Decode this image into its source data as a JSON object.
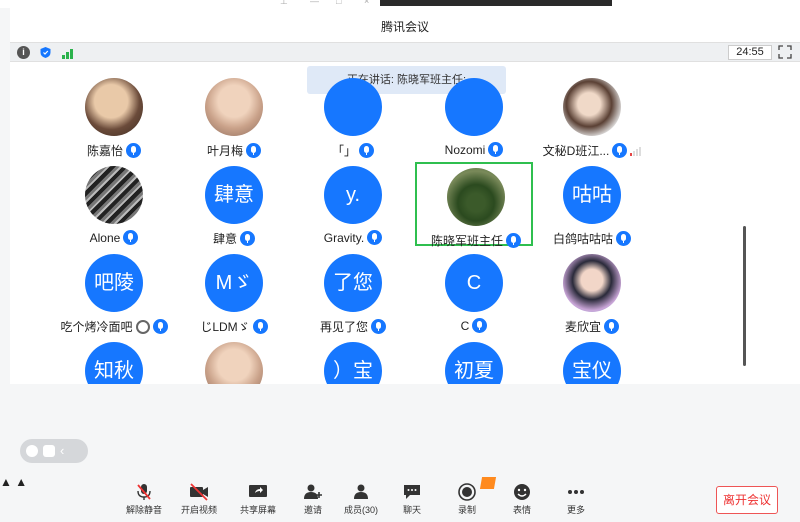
{
  "app": {
    "title": "腾讯会议"
  },
  "toolbar": {
    "timer": "24:55"
  },
  "speaker_banner": {
    "text": "正在讲话: 陈晓军班主任;"
  },
  "participants": [
    {
      "name": "陈嘉怡",
      "avatar_text": "",
      "avatar_style": "photo-a",
      "mic": true
    },
    {
      "name": "叶月梅",
      "avatar_text": "",
      "avatar_style": "photo-b",
      "mic": true
    },
    {
      "name": "「」",
      "avatar_text": "",
      "avatar_style": "blue",
      "mic": true
    },
    {
      "name": "Nozomi",
      "avatar_text": "",
      "avatar_style": "blue",
      "mic": true
    },
    {
      "name": "文秘D班江...",
      "avatar_text": "",
      "avatar_style": "photo-f",
      "mic": true,
      "net": true
    },
    {
      "name": "Alone",
      "avatar_text": "",
      "avatar_style": "photo-c",
      "mic": true
    },
    {
      "name": "肆意",
      "avatar_text": "肆意",
      "avatar_style": "blue",
      "mic": true
    },
    {
      "name": "Gravity.",
      "avatar_text": "y.",
      "avatar_style": "blue",
      "mic": true
    },
    {
      "name": "陈晓军班主任",
      "avatar_text": "",
      "avatar_style": "photo-d",
      "mic": true,
      "active": true
    },
    {
      "name": "白鸽咕咕咕",
      "avatar_text": "咕咕",
      "avatar_style": "blue",
      "mic": true
    },
    {
      "name": "吃个烤冷面吧",
      "avatar_text": "吧陵",
      "avatar_style": "blue",
      "mic": true,
      "extra_icon": true
    },
    {
      "name": "じLDMゞ",
      "avatar_text": "Mゞ",
      "avatar_style": "blue",
      "mic": true
    },
    {
      "name": "再见了您",
      "avatar_text": "了您",
      "avatar_style": "blue",
      "mic": true
    },
    {
      "name": "C",
      "avatar_text": "C",
      "avatar_style": "blue",
      "mic": true
    },
    {
      "name": "麦欣宜",
      "avatar_text": "",
      "avatar_style": "photo-e",
      "mic": true
    },
    {
      "name": "",
      "avatar_text": "知秋",
      "avatar_style": "blue",
      "mic": false
    },
    {
      "name": "",
      "avatar_text": "",
      "avatar_style": "photo-b",
      "mic": false
    },
    {
      "name": "",
      "avatar_text": "）宝",
      "avatar_style": "blue",
      "mic": false
    },
    {
      "name": "",
      "avatar_text": "初夏",
      "avatar_style": "blue",
      "mic": false
    },
    {
      "name": "",
      "avatar_text": "宝仪",
      "avatar_style": "blue",
      "mic": false
    }
  ],
  "bottom_bar": {
    "unmute": "解除静音",
    "start_video": "开启视频",
    "share_screen": "共享屏幕",
    "invite": "邀请",
    "members": "成员(30)",
    "chat": "聊天",
    "record": "录制",
    "reactions": "表情",
    "more": "更多",
    "leave": "离开会议"
  },
  "colors": {
    "accent": "#1677ff",
    "active_border": "#2fbf4f",
    "leave": "#e33333"
  }
}
